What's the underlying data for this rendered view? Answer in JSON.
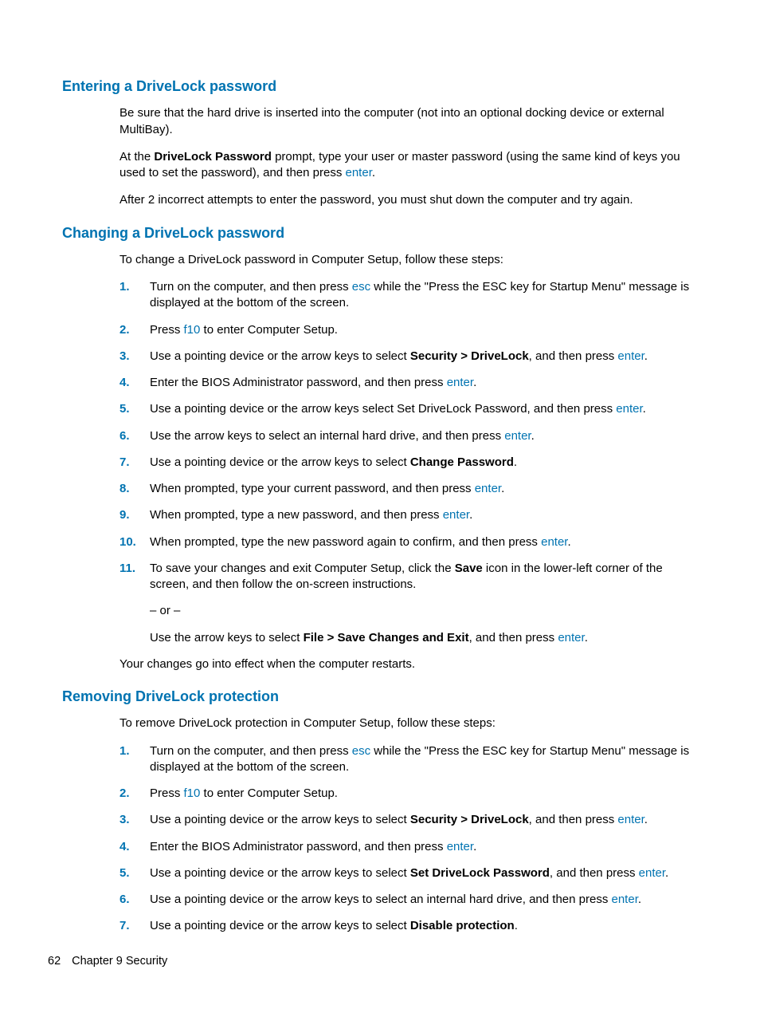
{
  "section1": {
    "heading": "Entering a DriveLock password",
    "p1": "Be sure that the hard drive is inserted into the computer (not into an optional docking device or external MultiBay).",
    "p2a": "At the ",
    "p2b": "DriveLock Password",
    "p2c": " prompt, type your user or master password (using the same kind of keys you used to set the password), and then press ",
    "p2d": "enter",
    "p2e": ".",
    "p3": "After 2 incorrect attempts to enter the password, you must shut down the computer and try again."
  },
  "section2": {
    "heading": "Changing a DriveLock password",
    "intro": "To change a DriveLock password in Computer Setup, follow these steps:",
    "s1a": "Turn on the computer, and then press ",
    "s1b": "esc",
    "s1c": " while the \"Press the ESC key for Startup Menu\" message is displayed at the bottom of the screen.",
    "s2a": "Press ",
    "s2b": "f10",
    "s2c": " to enter Computer Setup.",
    "s3a": "Use a pointing device or the arrow keys to select ",
    "s3b": "Security > DriveLock",
    "s3c": ", and then press ",
    "s3d": "enter",
    "s3e": ".",
    "s4a": "Enter the BIOS Administrator password, and then press ",
    "s4b": "enter",
    "s4c": ".",
    "s5a": "Use a pointing device or the arrow keys select Set DriveLock Password, and then press ",
    "s5b": "enter",
    "s5c": ".",
    "s6a": "Use the arrow keys to select an internal hard drive, and then press ",
    "s6b": "enter",
    "s6c": ".",
    "s7a": "Use a pointing device or the arrow keys to select ",
    "s7b": "Change Password",
    "s7c": ".",
    "s8a": "When prompted, type your current password, and then press ",
    "s8b": "enter",
    "s8c": ".",
    "s9a": "When prompted, type a new password, and then press ",
    "s9b": "enter",
    "s9c": ".",
    "s10a": "When prompted, type the new password again to confirm, and then press ",
    "s10b": "enter",
    "s10c": ".",
    "s11a": "To save your changes and exit Computer Setup, click the ",
    "s11b": "Save",
    "s11c": " icon in the lower-left corner of the screen, and then follow the on-screen instructions.",
    "s11or": "– or –",
    "s11d": "Use the arrow keys to select ",
    "s11e": "File > Save Changes and Exit",
    "s11f": ", and then press ",
    "s11g": "enter",
    "s11h": ".",
    "outro": "Your changes go into effect when the computer restarts."
  },
  "section3": {
    "heading": "Removing DriveLock protection",
    "intro": "To remove DriveLock protection in Computer Setup, follow these steps:",
    "s1a": "Turn on the computer, and then press ",
    "s1b": "esc",
    "s1c": " while the \"Press the ESC key for Startup Menu\" message is displayed at the bottom of the screen.",
    "s2a": "Press ",
    "s2b": "f10",
    "s2c": " to enter Computer Setup.",
    "s3a": "Use a pointing device or the arrow keys to select ",
    "s3b": "Security > DriveLock",
    "s3c": ", and then press ",
    "s3d": "enter",
    "s3e": ".",
    "s4a": "Enter the BIOS Administrator password, and then press ",
    "s4b": "enter",
    "s4c": ".",
    "s5a": "Use a pointing device or the arrow keys to select ",
    "s5b": "Set DriveLock Password",
    "s5c": ", and then press ",
    "s5d": "enter",
    "s5e": ".",
    "s6a": "Use a pointing device or the arrow keys to select an internal hard drive, and then press ",
    "s6b": "enter",
    "s6c": ".",
    "s7a": "Use a pointing device or the arrow keys to select ",
    "s7b": "Disable protection",
    "s7c": "."
  },
  "footer": {
    "page": "62",
    "chapter": "Chapter 9   Security"
  },
  "nums": {
    "n1": "1.",
    "n2": "2.",
    "n3": "3.",
    "n4": "4.",
    "n5": "5.",
    "n6": "6.",
    "n7": "7.",
    "n8": "8.",
    "n9": "9.",
    "n10": "10.",
    "n11": "11."
  }
}
